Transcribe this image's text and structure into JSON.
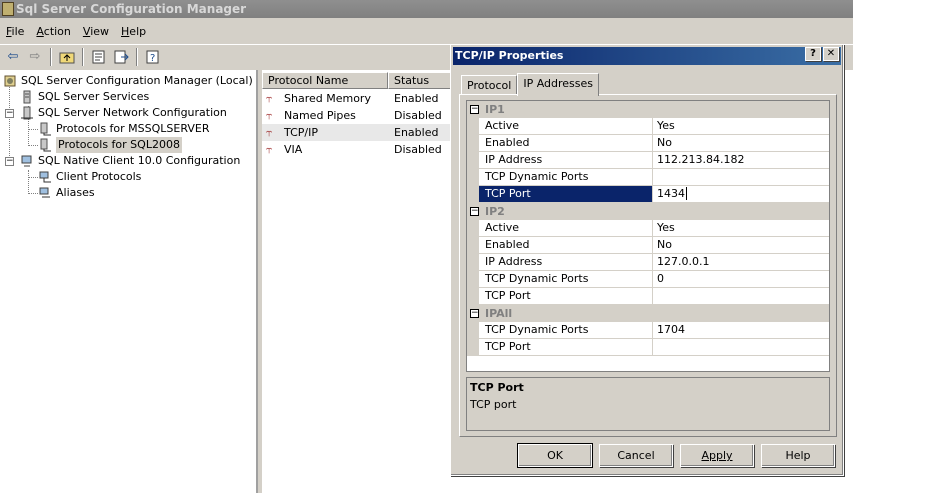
{
  "window": {
    "title": "Sql Server Configuration Manager"
  },
  "menu": [
    {
      "label": "File",
      "accel": "F",
      "rest": "ile"
    },
    {
      "label": "Action",
      "accel": "A",
      "rest": "ction"
    },
    {
      "label": "View",
      "accel": "V",
      "rest": "iew"
    },
    {
      "label": "Help",
      "accel": "H",
      "rest": "elp"
    }
  ],
  "toolbar": {
    "icons": [
      "back-arrow-icon",
      "forward-arrow-icon",
      "up-folder-icon",
      "properties-icon",
      "export-icon",
      "help-icon"
    ]
  },
  "tree": {
    "root": "SQL Server Configuration Manager (Local)",
    "services": "SQL Server Services",
    "network": "SQL Server Network Configuration",
    "proto_mssql": "Protocols for MSSQLSERVER",
    "proto_sql2008": "Protocols for SQL2008",
    "native_client": "SQL Native Client 10.0 Configuration",
    "client_protocols": "Client Protocols",
    "aliases": "Aliases"
  },
  "list": {
    "headers": {
      "name": "Protocol Name",
      "status": "Status"
    },
    "rows": [
      {
        "name": "Shared Memory",
        "status": "Enabled"
      },
      {
        "name": "Named Pipes",
        "status": "Disabled"
      },
      {
        "name": "TCP/IP",
        "status": "Enabled"
      },
      {
        "name": "VIA",
        "status": "Disabled"
      }
    ]
  },
  "dialog": {
    "title": "TCP/IP Properties",
    "help_btn": "?",
    "close_btn": "✕",
    "tabs": {
      "protocol": "Protocol",
      "ip": "IP Addresses"
    },
    "ip1": {
      "name": "IP1",
      "active_label": "Active",
      "active": "Yes",
      "enabled_label": "Enabled",
      "enabled": "No",
      "addr_label": "IP Address",
      "addr": "112.213.84.182",
      "dyn_label": "TCP Dynamic Ports",
      "dyn": "",
      "port_label": "TCP Port",
      "port": "1434"
    },
    "ip2": {
      "name": "IP2",
      "active_label": "Active",
      "active": "Yes",
      "enabled_label": "Enabled",
      "enabled": "No",
      "addr_label": "IP Address",
      "addr": "127.0.0.1",
      "dyn_label": "TCP Dynamic Ports",
      "dyn": "0",
      "port_label": "TCP Port",
      "port": ""
    },
    "ipall": {
      "name": "IPAll",
      "dyn_label": "TCP Dynamic Ports",
      "dyn": "1704",
      "port_label": "TCP Port",
      "port": ""
    },
    "desc": {
      "title": "TCP Port",
      "text": "TCP port"
    },
    "buttons": {
      "ok": "OK",
      "cancel": "Cancel",
      "apply": "Apply",
      "help": "Help"
    }
  }
}
